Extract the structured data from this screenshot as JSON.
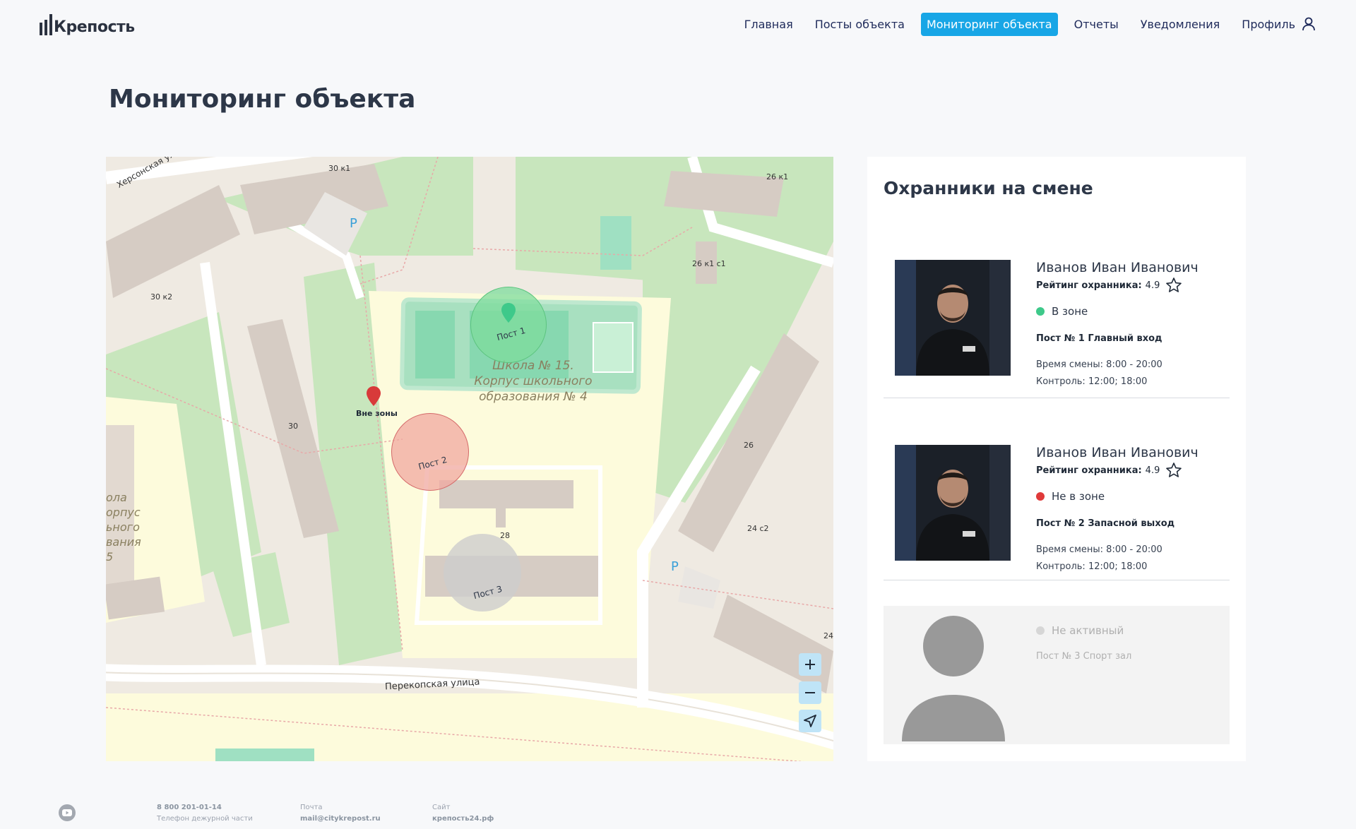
{
  "brand": {
    "name": "Крепость"
  },
  "nav": {
    "items": [
      {
        "label": "Главная",
        "active": false
      },
      {
        "label": "Посты объекта",
        "active": false
      },
      {
        "label": "Мониторинг объекта",
        "active": true
      },
      {
        "label": "Отчеты",
        "active": false
      },
      {
        "label": "Уведомления",
        "active": false
      },
      {
        "label": "Профиль",
        "active": false,
        "icon": "user-icon"
      }
    ],
    "active_color": "#18a6e6"
  },
  "page": {
    "title": "Мониторинг объекта"
  },
  "map": {
    "posts": [
      {
        "label": "Пост 1",
        "state": "in-zone",
        "color": "#7ddc9c"
      },
      {
        "label": "Пост 2",
        "state": "out-of-zone",
        "color": "#f0a8a0"
      },
      {
        "label": "Пост 3",
        "state": "inactive",
        "color": "#cfcfcf"
      }
    ],
    "marker_out_label": "Вне зоны",
    "school_label": "Школа № 15. Корпус школьного образования № 4",
    "street_label": "Перекопская улица",
    "street_label_2": "Херсонская ул.",
    "house_labels": [
      "30 к1",
      "26 к1",
      "30 к2",
      "26 к1 с1",
      "30",
      "26",
      "24 с2",
      "28",
      "24"
    ],
    "parking_label": "P",
    "left_building_label": "ола\nорпус\nьного\nвания\n5",
    "controls": {
      "zoom_in": "zoom-in",
      "zoom_out": "zoom-out",
      "locate": "locate"
    }
  },
  "guards_panel": {
    "title": "Охранники на смене",
    "rating_label": "Рейтинг охранника:",
    "shift_label": "Время смены:",
    "control_label": "Контроль:",
    "guards": [
      {
        "name": "Иванов Иван Иванович",
        "rating": "4.9",
        "status": "В зоне",
        "status_color": "#3ec98a",
        "post": "Пост № 1  Главный вход",
        "shift": "8:00 - 20:00",
        "control": "12:00; 18:00"
      },
      {
        "name": "Иванов Иван Иванович",
        "rating": "4.9",
        "status": "Не в зоне",
        "status_color": "#e03a3a",
        "post": "Пост № 2  Запасной выход",
        "shift": "8:00 - 20:00",
        "control": "12:00; 18:00"
      }
    ],
    "inactive": {
      "status": "Не активный",
      "status_color": "#d6d6d6",
      "post": "Пост № 3  Спорт зал"
    }
  },
  "footer": {
    "phone": "8 800 201-01-14",
    "phone_caption": "Телефон дежурной части",
    "mail_caption": "Почта",
    "mail": "mail@citykrepost.ru",
    "site_caption": "Сайт",
    "site": "крепость24.рф",
    "social_icon": "youtube-icon"
  }
}
